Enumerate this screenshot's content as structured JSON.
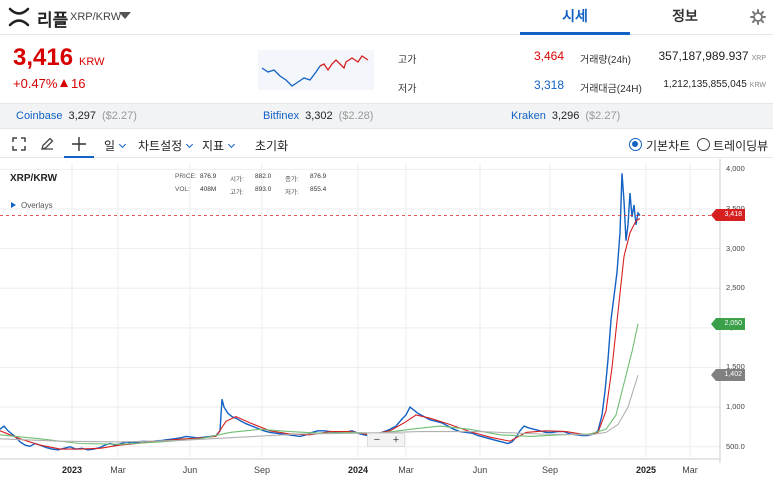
{
  "header": {
    "coin_name": "리플",
    "pair": "XRP/KRW",
    "tabs": [
      {
        "label": "시세",
        "active": true
      },
      {
        "label": "정보",
        "active": false
      }
    ]
  },
  "summary": {
    "price": "3,416",
    "unit": "KRW",
    "change_pct": "+0.47%",
    "change_abs": "16",
    "high_label": "고가",
    "high_value": "3,464",
    "low_label": "저가",
    "low_value": "3,318",
    "volume_label": "거래량(24h)",
    "volume_value": "357,187,989.937",
    "volume_unit": "XRP",
    "amount_label": "거래대금(24H)",
    "amount_value": "1,212,135,855,045",
    "amount_unit": "KRW"
  },
  "exchanges": [
    {
      "name": "Coinbase",
      "price": "3,297",
      "usd": "($2.27)"
    },
    {
      "name": "Bitfinex",
      "price": "3,302",
      "usd": "($2.28)"
    },
    {
      "name": "Kraken",
      "price": "3,296",
      "usd": "($2.27)"
    }
  ],
  "toolbar": {
    "interval": "일",
    "chart_settings": "차트설정",
    "indicators": "지표",
    "reset": "초기화",
    "basic_chart": "기본차트",
    "tradingview": "트레이딩뷰",
    "selected": "basic"
  },
  "chart_info": {
    "symbol": "XRP/KRW",
    "overlays": "Overlays",
    "price_label": "PRICE:",
    "price": "876.9",
    "open_label": "시가:",
    "open": "882.0",
    "close_label": "종가:",
    "close": "876.9",
    "vol_label": "VOL:",
    "vol": "408M",
    "high_label": "고가:",
    "high": "893.0",
    "low_label": "저가:",
    "low": "855.4",
    "zoom_out": "−",
    "zoom_in": "+"
  },
  "chart_data": {
    "type": "line",
    "y_ticks": [
      "4,000",
      "3,500",
      "3,000",
      "2,500",
      "2,000",
      "1,500",
      "1,000",
      "500.0"
    ],
    "x_ticks": [
      {
        "label": "2023",
        "bold": true
      },
      {
        "label": "Mar",
        "bold": false
      },
      {
        "label": "Jun",
        "bold": false
      },
      {
        "label": "Sep",
        "bold": false
      },
      {
        "label": "2024",
        "bold": true
      },
      {
        "label": "Mar",
        "bold": false
      },
      {
        "label": "Jun",
        "bold": false
      },
      {
        "label": "Sep",
        "bold": false
      },
      {
        "label": "2025",
        "bold": true
      },
      {
        "label": "Mar",
        "bold": false
      }
    ],
    "ylim": [
      370,
      4080
    ],
    "series": [
      {
        "key": "price",
        "color": "#1261c4",
        "values": [
          [
            0,
            720
          ],
          [
            4,
            760
          ],
          [
            8,
            700
          ],
          [
            12,
            660
          ],
          [
            16,
            620
          ],
          [
            20,
            560
          ],
          [
            25,
            520
          ],
          [
            30,
            505
          ],
          [
            35,
            540
          ],
          [
            40,
            520
          ],
          [
            46,
            490
          ],
          [
            52,
            470
          ],
          [
            58,
            460
          ],
          [
            64,
            480
          ],
          [
            70,
            500
          ],
          [
            76,
            470
          ],
          [
            82,
            480
          ],
          [
            88,
            460
          ],
          [
            94,
            470
          ],
          [
            100,
            490
          ],
          [
            105,
            520
          ],
          [
            110,
            540
          ],
          [
            115,
            520
          ],
          [
            120,
            535
          ],
          [
            126,
            560
          ],
          [
            132,
            545
          ],
          [
            138,
            560
          ],
          [
            144,
            570
          ],
          [
            150,
            560
          ],
          [
            156,
            575
          ],
          [
            162,
            580
          ],
          [
            168,
            590
          ],
          [
            174,
            600
          ],
          [
            180,
            610
          ],
          [
            186,
            630
          ],
          [
            192,
            620
          ],
          [
            198,
            610
          ],
          [
            204,
            620
          ],
          [
            210,
            630
          ],
          [
            216,
            640
          ],
          [
            220,
            700
          ],
          [
            222,
            1100
          ],
          [
            224,
            1000
          ],
          [
            228,
            920
          ],
          [
            232,
            880
          ],
          [
            236,
            860
          ],
          [
            240,
            830
          ],
          [
            246,
            790
          ],
          [
            252,
            760
          ],
          [
            258,
            730
          ],
          [
            264,
            700
          ],
          [
            270,
            680
          ],
          [
            276,
            670
          ],
          [
            282,
            660
          ],
          [
            288,
            650
          ],
          [
            294,
            640
          ],
          [
            300,
            630
          ],
          [
            306,
            650
          ],
          [
            312,
            680
          ],
          [
            318,
            700
          ],
          [
            324,
            700
          ],
          [
            330,
            690
          ],
          [
            336,
            680
          ],
          [
            342,
            680
          ],
          [
            348,
            690
          ],
          [
            352,
            700
          ],
          [
            356,
            680
          ],
          [
            360,
            660
          ],
          [
            364,
            650
          ],
          [
            368,
            640
          ],
          [
            372,
            650
          ],
          [
            378,
            660
          ],
          [
            384,
            690
          ],
          [
            390,
            720
          ],
          [
            396,
            760
          ],
          [
            402,
            850
          ],
          [
            406,
            900
          ],
          [
            410,
            1000
          ],
          [
            414,
            960
          ],
          [
            418,
            920
          ],
          [
            424,
            880
          ],
          [
            430,
            840
          ],
          [
            436,
            820
          ],
          [
            442,
            800
          ],
          [
            448,
            760
          ],
          [
            454,
            720
          ],
          [
            460,
            690
          ],
          [
            466,
            680
          ],
          [
            472,
            670
          ],
          [
            478,
            640
          ],
          [
            484,
            620
          ],
          [
            490,
            600
          ],
          [
            496,
            580
          ],
          [
            502,
            560
          ],
          [
            508,
            540
          ],
          [
            512,
            560
          ],
          [
            516,
            620
          ],
          [
            520,
            700
          ],
          [
            524,
            760
          ],
          [
            528,
            740
          ],
          [
            534,
            720
          ],
          [
            540,
            700
          ],
          [
            546,
            680
          ],
          [
            552,
            680
          ],
          [
            558,
            690
          ],
          [
            564,
            690
          ],
          [
            570,
            660
          ],
          [
            576,
            650
          ],
          [
            582,
            640
          ],
          [
            588,
            640
          ],
          [
            594,
            660
          ],
          [
            598,
            700
          ],
          [
            602,
            900
          ],
          [
            605,
            1200
          ],
          [
            608,
            1600
          ],
          [
            611,
            2100
          ],
          [
            614,
            2400
          ],
          [
            617,
            2700
          ],
          [
            620,
            3200
          ],
          [
            622,
            3950
          ],
          [
            624,
            3600
          ],
          [
            626,
            3100
          ],
          [
            628,
            3300
          ],
          [
            630,
            3700
          ],
          [
            632,
            3400
          ],
          [
            634,
            3550
          ],
          [
            636,
            3300
          ],
          [
            638,
            3450
          ],
          [
            640,
            3416
          ]
        ]
      },
      {
        "key": "ma_short",
        "color": "#d62020",
        "values": [
          [
            0,
            700
          ],
          [
            20,
            600
          ],
          [
            40,
            520
          ],
          [
            60,
            470
          ],
          [
            80,
            470
          ],
          [
            100,
            480
          ],
          [
            120,
            520
          ],
          [
            140,
            545
          ],
          [
            160,
            570
          ],
          [
            180,
            595
          ],
          [
            200,
            610
          ],
          [
            216,
            630
          ],
          [
            226,
            820
          ],
          [
            236,
            880
          ],
          [
            250,
            800
          ],
          [
            270,
            700
          ],
          [
            290,
            660
          ],
          [
            310,
            650
          ],
          [
            330,
            690
          ],
          [
            350,
            690
          ],
          [
            370,
            650
          ],
          [
            390,
            700
          ],
          [
            404,
            800
          ],
          [
            416,
            900
          ],
          [
            430,
            860
          ],
          [
            450,
            780
          ],
          [
            470,
            690
          ],
          [
            490,
            620
          ],
          [
            510,
            570
          ],
          [
            526,
            680
          ],
          [
            546,
            700
          ],
          [
            566,
            690
          ],
          [
            586,
            650
          ],
          [
            598,
            680
          ],
          [
            606,
            950
          ],
          [
            612,
            1500
          ],
          [
            618,
            2200
          ],
          [
            624,
            2900
          ],
          [
            630,
            3200
          ],
          [
            636,
            3350
          ],
          [
            640,
            3380
          ]
        ]
      },
      {
        "key": "ma_mid",
        "color": "#6fbf73",
        "values": [
          [
            0,
            650
          ],
          [
            40,
            600
          ],
          [
            80,
            540
          ],
          [
            120,
            530
          ],
          [
            160,
            560
          ],
          [
            200,
            600
          ],
          [
            230,
            680
          ],
          [
            260,
            720
          ],
          [
            290,
            690
          ],
          [
            320,
            670
          ],
          [
            350,
            680
          ],
          [
            380,
            670
          ],
          [
            410,
            720
          ],
          [
            440,
            760
          ],
          [
            470,
            720
          ],
          [
            500,
            650
          ],
          [
            530,
            630
          ],
          [
            560,
            650
          ],
          [
            590,
            660
          ],
          [
            606,
            720
          ],
          [
            616,
            900
          ],
          [
            624,
            1300
          ],
          [
            632,
            1700
          ],
          [
            638,
            2050
          ]
        ]
      },
      {
        "key": "ma_long",
        "color": "#b0b0b0",
        "values": [
          [
            0,
            600
          ],
          [
            60,
            570
          ],
          [
            120,
            560
          ],
          [
            180,
            580
          ],
          [
            240,
            620
          ],
          [
            300,
            660
          ],
          [
            360,
            670
          ],
          [
            420,
            690
          ],
          [
            480,
            690
          ],
          [
            540,
            660
          ],
          [
            590,
            650
          ],
          [
            606,
            680
          ],
          [
            618,
            780
          ],
          [
            628,
            1000
          ],
          [
            638,
            1402
          ]
        ]
      }
    ],
    "last_price": "3,416",
    "tags": [
      {
        "label": "3,418",
        "value": 3418,
        "color": "#d62020"
      },
      {
        "label": "2,050",
        "value": 2050,
        "color": "#3aa04a"
      },
      {
        "label": "1,402",
        "value": 1402,
        "color": "#808080"
      }
    ]
  }
}
